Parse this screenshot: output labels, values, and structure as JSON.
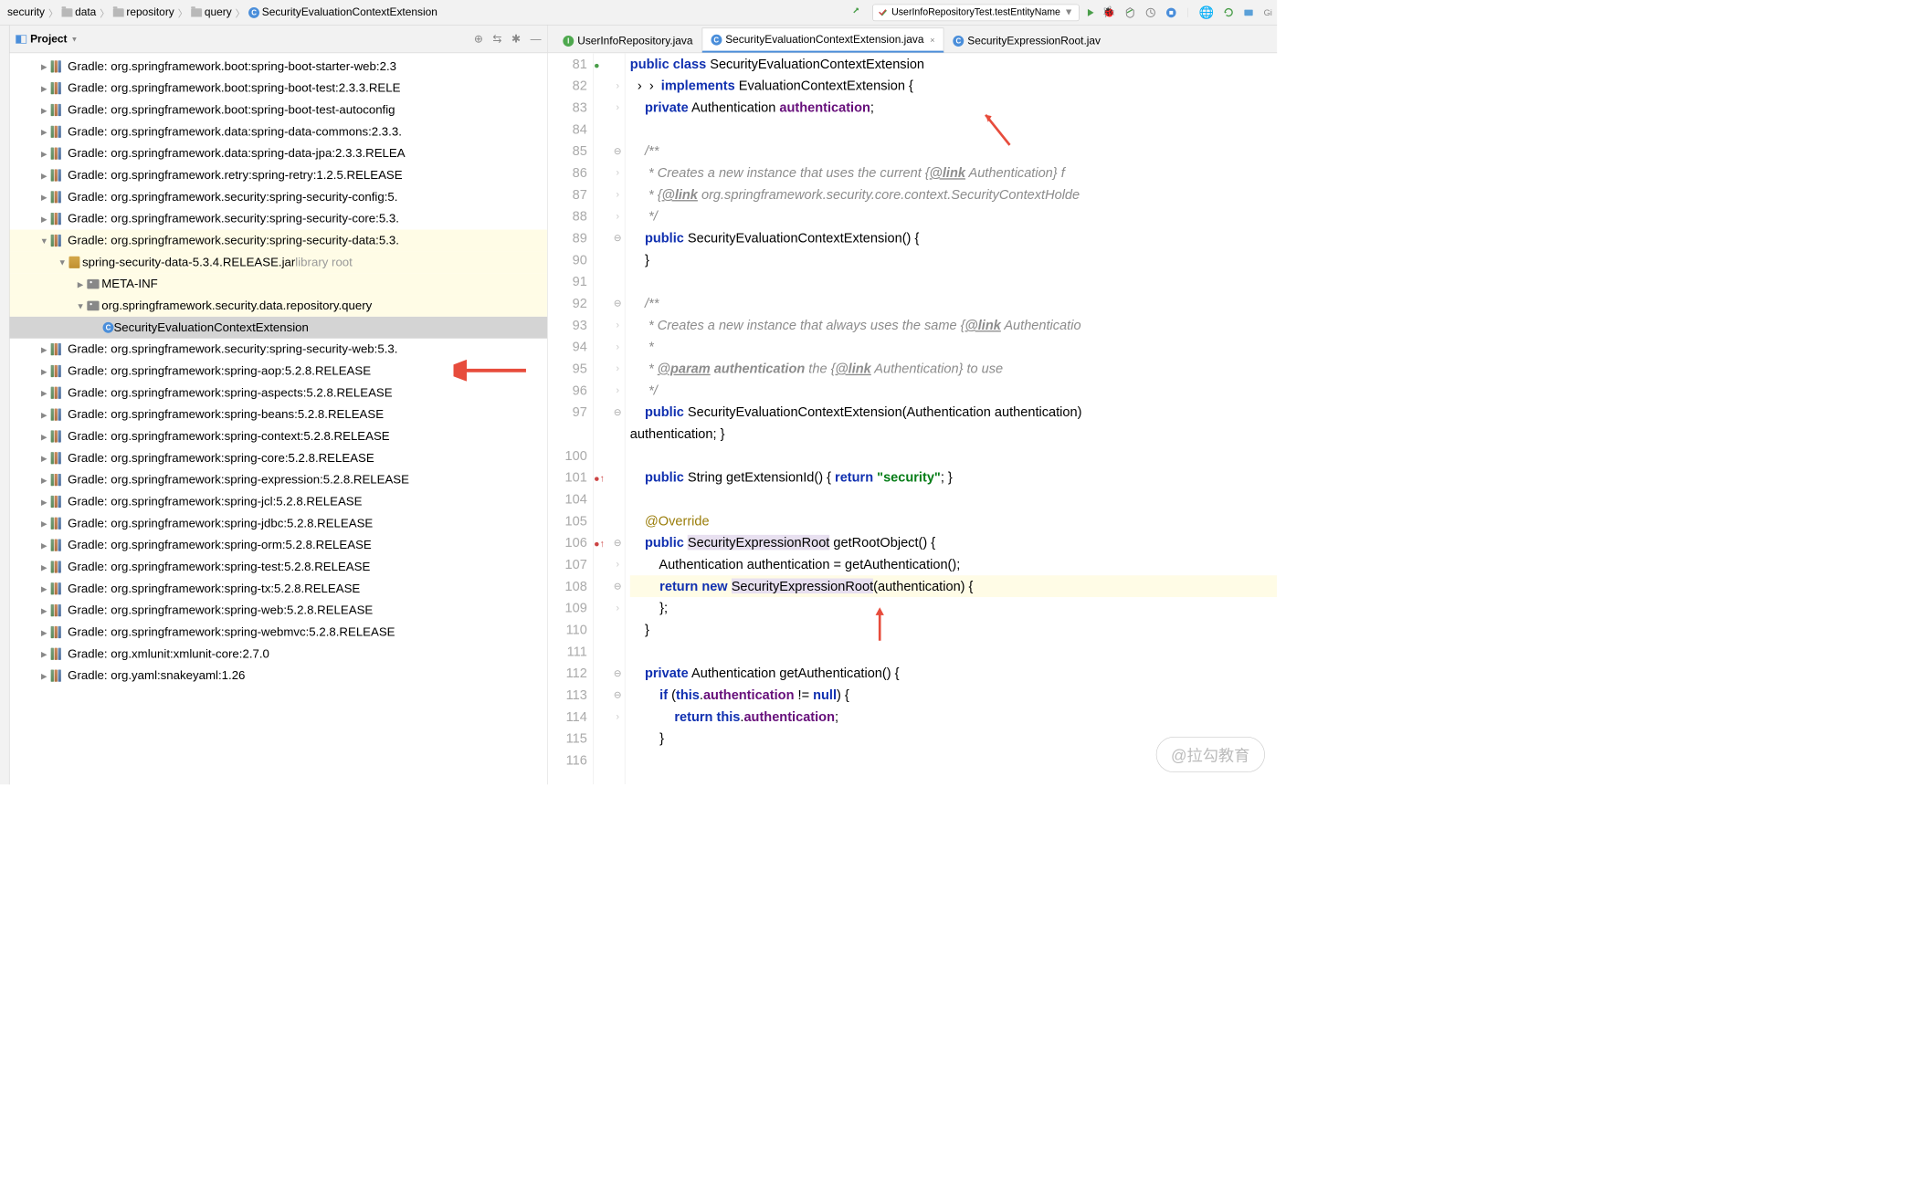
{
  "breadcrumb": [
    "security",
    "data",
    "repository",
    "query",
    "SecurityEvaluationContextExtension"
  ],
  "runConfig": "UserInfoRepositoryTest.testEntityName",
  "panelTitle": "Project",
  "tree": [
    {
      "ind": 1,
      "arr": "closed",
      "ic": "lib",
      "text": "Gradle: org.springframework.boot:spring-boot-starter-web:2.3"
    },
    {
      "ind": 1,
      "arr": "closed",
      "ic": "lib",
      "text": "Gradle: org.springframework.boot:spring-boot-test:2.3.3.RELE"
    },
    {
      "ind": 1,
      "arr": "closed",
      "ic": "lib",
      "text": "Gradle: org.springframework.boot:spring-boot-test-autoconfig"
    },
    {
      "ind": 1,
      "arr": "closed",
      "ic": "lib",
      "text": "Gradle: org.springframework.data:spring-data-commons:2.3.3."
    },
    {
      "ind": 1,
      "arr": "closed",
      "ic": "lib",
      "text": "Gradle: org.springframework.data:spring-data-jpa:2.3.3.RELEA"
    },
    {
      "ind": 1,
      "arr": "closed",
      "ic": "lib",
      "text": "Gradle: org.springframework.retry:spring-retry:1.2.5.RELEASE"
    },
    {
      "ind": 1,
      "arr": "closed",
      "ic": "lib",
      "text": "Gradle: org.springframework.security:spring-security-config:5."
    },
    {
      "ind": 1,
      "arr": "closed",
      "ic": "lib",
      "text": "Gradle: org.springframework.security:spring-security-core:5.3."
    },
    {
      "ind": 1,
      "arr": "open",
      "ic": "lib",
      "text": "Gradle: org.springframework.security:spring-security-data:5.3.",
      "hl": true
    },
    {
      "ind": 2,
      "arr": "open",
      "ic": "jar",
      "text": "spring-security-data-5.3.4.RELEASE.jar",
      "suffix": "  library root",
      "hl": true
    },
    {
      "ind": 3,
      "arr": "closed",
      "ic": "pkg",
      "text": "META-INF",
      "hl": true
    },
    {
      "ind": 3,
      "arr": "open",
      "ic": "pkg",
      "text": "org.springframework.security.data.repository.query",
      "hl": true
    },
    {
      "ind": 4,
      "arr": "none",
      "ic": "class",
      "text": "SecurityEvaluationContextExtension",
      "sel": true
    },
    {
      "ind": 1,
      "arr": "closed",
      "ic": "lib",
      "text": "Gradle: org.springframework.security:spring-security-web:5.3."
    },
    {
      "ind": 1,
      "arr": "closed",
      "ic": "lib",
      "text": "Gradle: org.springframework:spring-aop:5.2.8.RELEASE"
    },
    {
      "ind": 1,
      "arr": "closed",
      "ic": "lib",
      "text": "Gradle: org.springframework:spring-aspects:5.2.8.RELEASE"
    },
    {
      "ind": 1,
      "arr": "closed",
      "ic": "lib",
      "text": "Gradle: org.springframework:spring-beans:5.2.8.RELEASE"
    },
    {
      "ind": 1,
      "arr": "closed",
      "ic": "lib",
      "text": "Gradle: org.springframework:spring-context:5.2.8.RELEASE"
    },
    {
      "ind": 1,
      "arr": "closed",
      "ic": "lib",
      "text": "Gradle: org.springframework:spring-core:5.2.8.RELEASE"
    },
    {
      "ind": 1,
      "arr": "closed",
      "ic": "lib",
      "text": "Gradle: org.springframework:spring-expression:5.2.8.RELEASE"
    },
    {
      "ind": 1,
      "arr": "closed",
      "ic": "lib",
      "text": "Gradle: org.springframework:spring-jcl:5.2.8.RELEASE"
    },
    {
      "ind": 1,
      "arr": "closed",
      "ic": "lib",
      "text": "Gradle: org.springframework:spring-jdbc:5.2.8.RELEASE"
    },
    {
      "ind": 1,
      "arr": "closed",
      "ic": "lib",
      "text": "Gradle: org.springframework:spring-orm:5.2.8.RELEASE"
    },
    {
      "ind": 1,
      "arr": "closed",
      "ic": "lib",
      "text": "Gradle: org.springframework:spring-test:5.2.8.RELEASE"
    },
    {
      "ind": 1,
      "arr": "closed",
      "ic": "lib",
      "text": "Gradle: org.springframework:spring-tx:5.2.8.RELEASE"
    },
    {
      "ind": 1,
      "arr": "closed",
      "ic": "lib",
      "text": "Gradle: org.springframework:spring-web:5.2.8.RELEASE"
    },
    {
      "ind": 1,
      "arr": "closed",
      "ic": "lib",
      "text": "Gradle: org.springframework:spring-webmvc:5.2.8.RELEASE"
    },
    {
      "ind": 1,
      "arr": "closed",
      "ic": "lib",
      "text": "Gradle: org.xmlunit:xmlunit-core:2.7.0"
    },
    {
      "ind": 1,
      "arr": "closed",
      "ic": "lib",
      "text": "Gradle: org.yaml:snakeyaml:1.26"
    }
  ],
  "tabs": [
    {
      "ic": "I",
      "name": "UserInfoRepository.java",
      "active": false
    },
    {
      "ic": "C",
      "name": "SecurityEvaluationContextExtension.java",
      "active": true
    },
    {
      "ic": "C",
      "name": "SecurityExpressionRoot.jav",
      "active": false
    }
  ],
  "lines": [
    {
      "n": 81,
      "html": "<span class='kw'>public</span> <span class='kw'>class</span> SecurityEvaluationContextExtension"
    },
    {
      "n": 82,
      "html": "  ›  ›  <span class='kw'>implements</span> EvaluationContextExtension {"
    },
    {
      "n": 83,
      "html": "    <span class='kw'>private</span> Authentication <span class='field'>authentication</span>;"
    },
    {
      "n": 84,
      "html": ""
    },
    {
      "n": 85,
      "html": "    <span class='doc'>/**</span>"
    },
    {
      "n": 86,
      "html": "    <span class='doc'> * Creates a new instance that uses the current {<span class='tag'>@link</span> Authentication} f</span>"
    },
    {
      "n": 87,
      "html": "    <span class='doc'> * {<span class='tag'>@link</span> org.springframework.security.core.context.SecurityContextHolde</span>"
    },
    {
      "n": 88,
      "html": "    <span class='doc'> */</span>"
    },
    {
      "n": 89,
      "html": "    <span class='kw'>public</span> SecurityEvaluationContextExtension() {"
    },
    {
      "n": 90,
      "html": "    }"
    },
    {
      "n": 91,
      "html": ""
    },
    {
      "n": 92,
      "html": "    <span class='doc'>/**</span>"
    },
    {
      "n": 93,
      "html": "    <span class='doc'> * Creates a new instance that always uses the same {<span class='tag'>@link</span> Authenticatio</span>"
    },
    {
      "n": 94,
      "html": "    <span class='doc'> *</span>"
    },
    {
      "n": 95,
      "html": "    <span class='doc'> * <span class='tag'>@param</span> <span style='font-weight:bold'>authentication</span> the {<span class='tag'>@link</span> Authentication} to use</span>"
    },
    {
      "n": 96,
      "html": "    <span class='doc'> */</span>"
    },
    {
      "n": 97,
      "html": "    <span class='kw'>public</span> SecurityEvaluationContextExtension(Authentication authentication)"
    },
    {
      "n": "",
      "html": "authentication; }"
    },
    {
      "n": 100,
      "html": ""
    },
    {
      "n": 101,
      "html": "    <span class='kw'>public</span> String getExtensionId() { <span class='kw'>return</span> <span class='str'>\"security\"</span>; }"
    },
    {
      "n": 104,
      "html": ""
    },
    {
      "n": 105,
      "html": "    <span class='ann'>@Override</span>"
    },
    {
      "n": 106,
      "html": "    <span class='kw'>public</span> <span class='hl'>SecurityExpressionRoot</span> getRootObject() {"
    },
    {
      "n": 107,
      "html": "        Authentication authentication = getAuthentication();"
    },
    {
      "n": 108,
      "html": "        <span class='kw'>return</span> <span class='kw'>new</span> <span class='hl'>SecurityExpressionRoot</span>(authentication) {",
      "hl": true
    },
    {
      "n": 109,
      "html": "        };"
    },
    {
      "n": 110,
      "html": "    }"
    },
    {
      "n": 111,
      "html": ""
    },
    {
      "n": 112,
      "html": "    <span class='kw'>private</span> Authentication getAuthentication() {"
    },
    {
      "n": 113,
      "html": "        <span class='kw'>if</span> (<span class='kw'>this</span>.<span class='field'>authentication</span> != <span class='kw'>null</span>) {"
    },
    {
      "n": 114,
      "html": "            <span class='kw'>return</span> <span class='kw'>this</span>.<span class='field'>authentication</span>;"
    },
    {
      "n": 115,
      "html": "        }"
    },
    {
      "n": 116,
      "html": ""
    }
  ],
  "watermark": "@拉勾教育"
}
